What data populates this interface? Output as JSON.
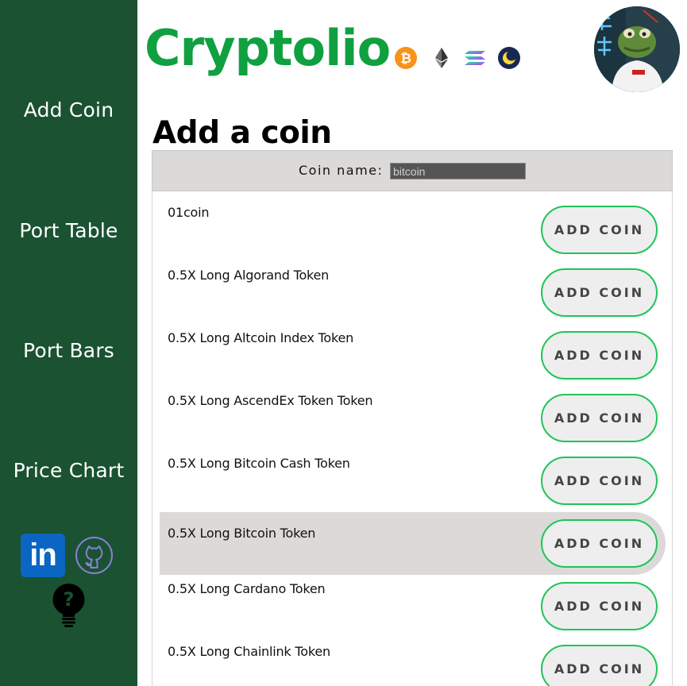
{
  "sidebar": {
    "items": [
      {
        "label": "Add Coin"
      },
      {
        "label": "Port Table"
      },
      {
        "label": "Port Bars"
      },
      {
        "label": "Price Chart"
      }
    ],
    "social": {
      "linkedin_text": "in"
    }
  },
  "header": {
    "brand": "Cryptolio",
    "coin_icons": [
      "bitcoin-icon",
      "ethereum-icon",
      "solana-icon",
      "terra-luna-icon"
    ]
  },
  "main": {
    "title": "Add a coin",
    "search": {
      "label": "Coin name:",
      "value": "",
      "placeholder": "bitcoin"
    },
    "add_label": "ADD COIN",
    "coins": [
      {
        "name": "01coin"
      },
      {
        "name": "0.5X Long Algorand Token"
      },
      {
        "name": "0.5X Long Altcoin Index Token"
      },
      {
        "name": "0.5X Long AscendEx Token Token"
      },
      {
        "name": "0.5X Long Bitcoin Cash Token"
      },
      {
        "name": "0.5X Long Bitcoin Token"
      },
      {
        "name": "0.5X Long Cardano Token"
      },
      {
        "name": "0.5X Long Chainlink Token"
      }
    ],
    "hovered_index": 5
  },
  "colors": {
    "sidebar_bg": "#1b5232",
    "brand_green": "#10a040",
    "button_border": "#1fc45a",
    "row_hover": "#dcdad8"
  }
}
